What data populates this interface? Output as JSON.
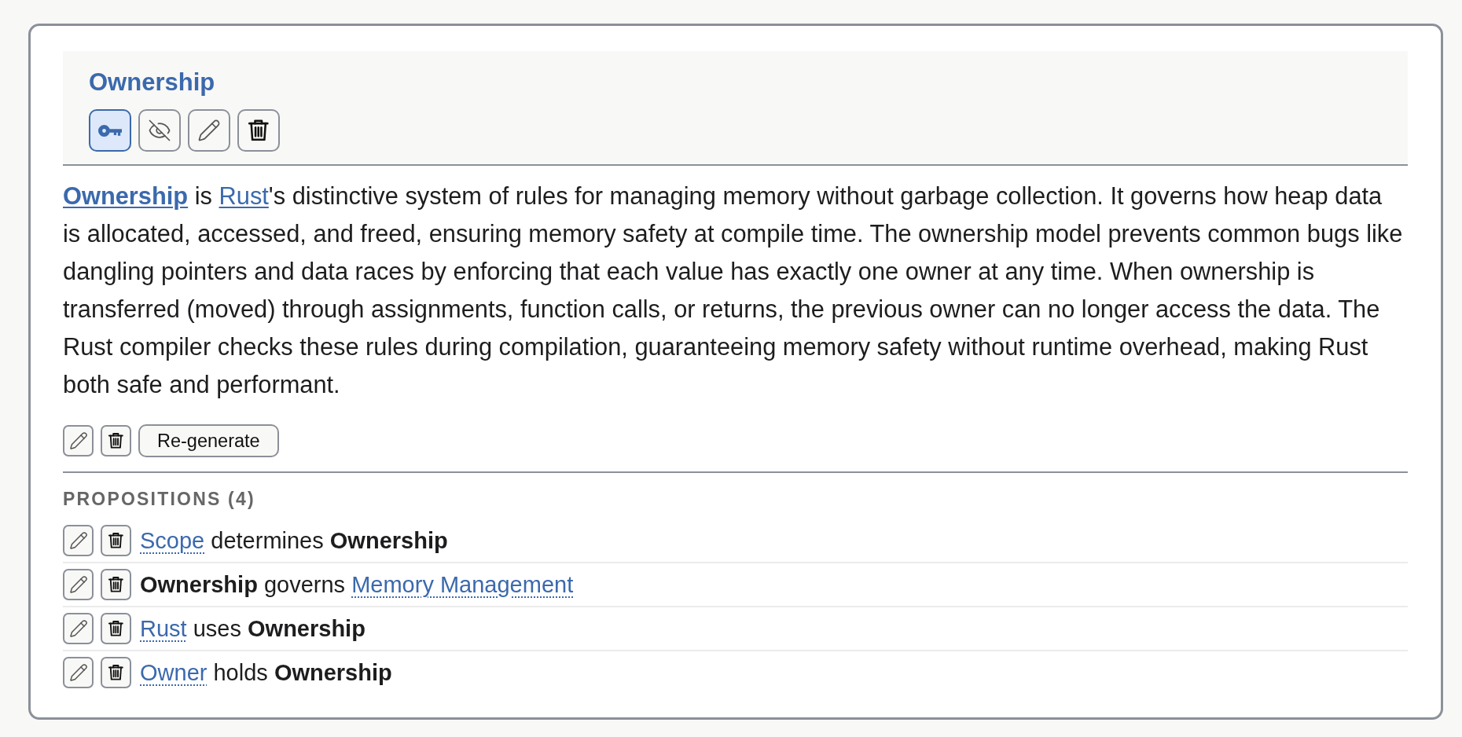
{
  "concept": {
    "title": "Ownership",
    "toolbar": [
      {
        "kind": "key",
        "selected": true
      },
      {
        "kind": "hide",
        "selected": false
      },
      {
        "kind": "edit",
        "selected": false
      },
      {
        "kind": "delete",
        "selected": false
      }
    ]
  },
  "description": {
    "segments": [
      {
        "kind": "bold_link",
        "text": "Ownership"
      },
      {
        "kind": "plain",
        "text": " is "
      },
      {
        "kind": "link",
        "text": "Rust"
      },
      {
        "kind": "plain",
        "text": "'s distinctive system of rules for managing memory without garbage collection. It governs how heap data is allocated, accessed, and freed, ensuring memory safety at compile time. The ownership model prevents common bugs like dangling pointers and data races by enforcing that each value has exactly one owner at any time. When ownership is transferred (moved) through assignments, function calls, or returns, the previous owner can no longer access the data. The Rust compiler checks these rules during compilation, guaranteeing memory safety without runtime overhead, making Rust both safe and performant."
      }
    ],
    "regenerate_label": "Re-generate"
  },
  "propositions": {
    "heading": "PROPOSITIONS (4)",
    "items": [
      {
        "parts": [
          {
            "kind": "link",
            "text": "Scope"
          },
          {
            "kind": "plain",
            "text": " determines "
          },
          {
            "kind": "bold",
            "text": "Ownership"
          }
        ]
      },
      {
        "parts": [
          {
            "kind": "bold",
            "text": "Ownership"
          },
          {
            "kind": "plain",
            "text": " governs "
          },
          {
            "kind": "link",
            "text": "Memory Management"
          }
        ]
      },
      {
        "parts": [
          {
            "kind": "link",
            "text": "Rust"
          },
          {
            "kind": "plain",
            "text": " uses "
          },
          {
            "kind": "bold",
            "text": "Ownership"
          }
        ]
      },
      {
        "parts": [
          {
            "kind": "link",
            "text": "Owner"
          },
          {
            "kind": "plain",
            "text": " holds "
          },
          {
            "kind": "bold",
            "text": "Ownership"
          }
        ]
      }
    ]
  }
}
